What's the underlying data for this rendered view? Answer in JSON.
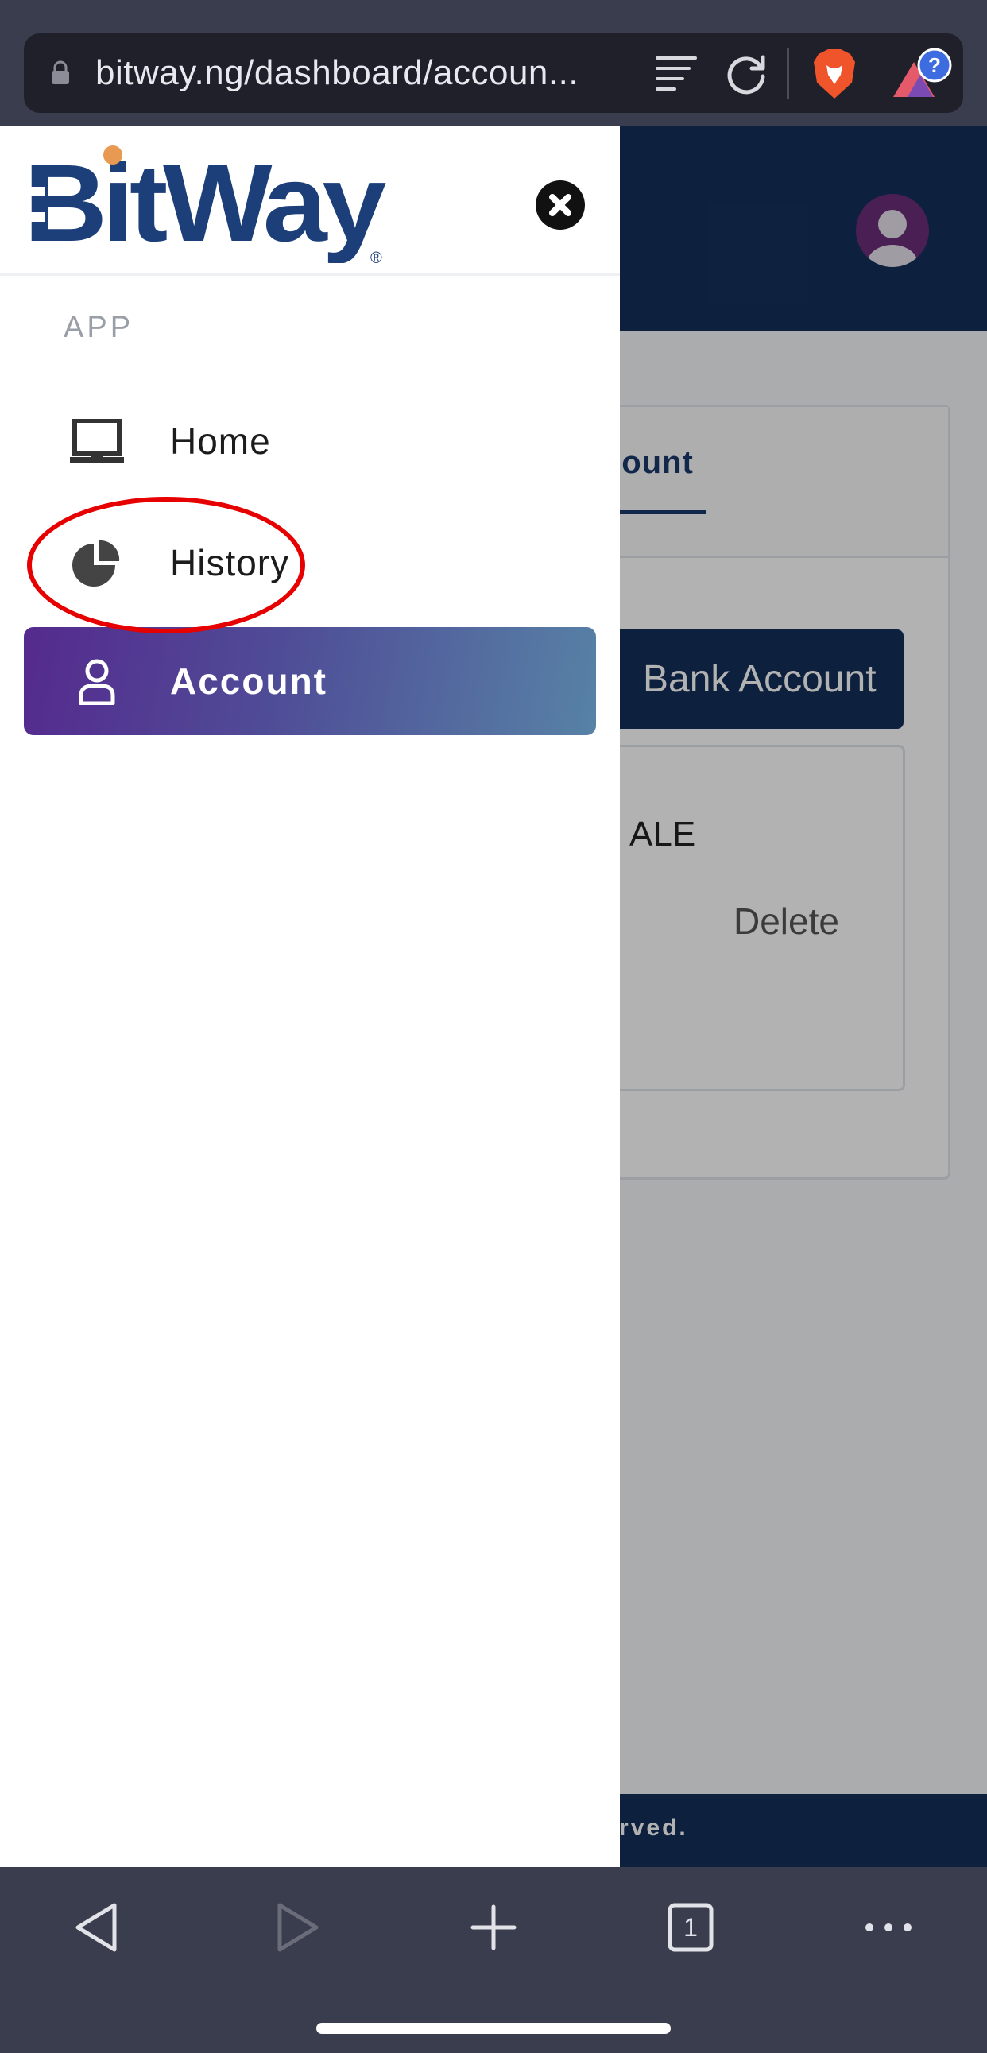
{
  "browser": {
    "url": "bitway.ng/dashboard/accoun...",
    "tab_count": "1"
  },
  "page": {
    "tab_active_label": "count",
    "add_bank_button": "Bank Account",
    "bank_name_partial": "ALE",
    "delete_label": "Delete",
    "footer_text": "eserved."
  },
  "drawer": {
    "logo_text": "BitWay",
    "section_label": "APP",
    "items": [
      {
        "label": "Home",
        "icon": "laptop-icon",
        "active": false
      },
      {
        "label": "History",
        "icon": "pie-chart-icon",
        "active": false
      },
      {
        "label": "Account",
        "icon": "user-icon",
        "active": true
      }
    ]
  },
  "colors": {
    "header_navy": "#14305a",
    "logo_blue": "#1c3f7a",
    "logo_dot_orange": "#e89a52",
    "active_gradient_start": "#552a8e",
    "active_gradient_end": "#5782a6",
    "annotation_red": "#e60000",
    "browser_chrome": "#3a3d4e"
  }
}
